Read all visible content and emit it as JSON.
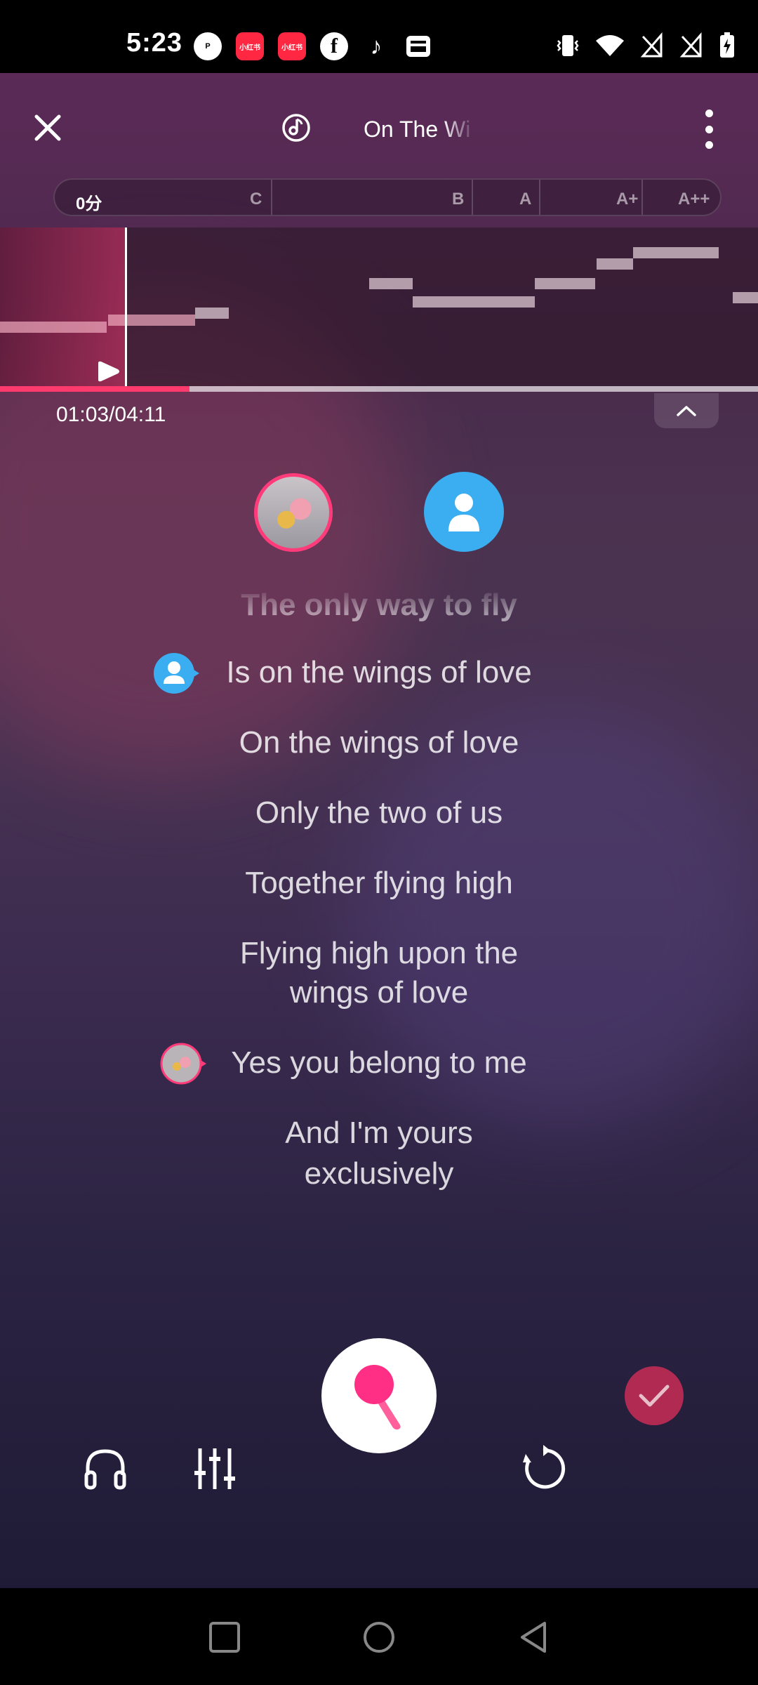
{
  "status_bar": {
    "time": "5:23",
    "apps": [
      {
        "name": "p-app-icon",
        "label": "P"
      },
      {
        "name": "xiaohongshu-icon",
        "label": "小红书"
      },
      {
        "name": "xiaohongshu-icon-2",
        "label": "小红书"
      },
      {
        "name": "facebook-icon",
        "label": "f"
      },
      {
        "name": "tiktok-icon",
        "label": "♪"
      },
      {
        "name": "wallet-icon",
        "label": ""
      }
    ]
  },
  "header": {
    "song_title": "On The Wi"
  },
  "score_bar": {
    "current_score": "0分",
    "grades": [
      "C",
      "B",
      "A",
      "A+",
      "A++"
    ]
  },
  "playback": {
    "time": "01:03/04:11",
    "progress": 0.25
  },
  "lyrics": {
    "previous": "The only way to fly",
    "lines": [
      {
        "text": "Is on the wings of love",
        "singer": "b"
      },
      {
        "text": "On the wings of love",
        "singer": ""
      },
      {
        "text": "Only the two of us",
        "singer": ""
      },
      {
        "text": "Together flying high",
        "singer": ""
      },
      {
        "text": "Flying high upon the",
        "singer": ""
      },
      {
        "text": "wings of love",
        "singer": ""
      },
      {
        "text": "Yes you belong to me",
        "singer": "a"
      },
      {
        "text": "And I'm yours",
        "singer": ""
      },
      {
        "text": "exclusively",
        "singer": ""
      }
    ]
  },
  "colors": {
    "accent": "#ff3b6e",
    "singer_b": "#3aaef0",
    "finish": "#b02a52"
  }
}
